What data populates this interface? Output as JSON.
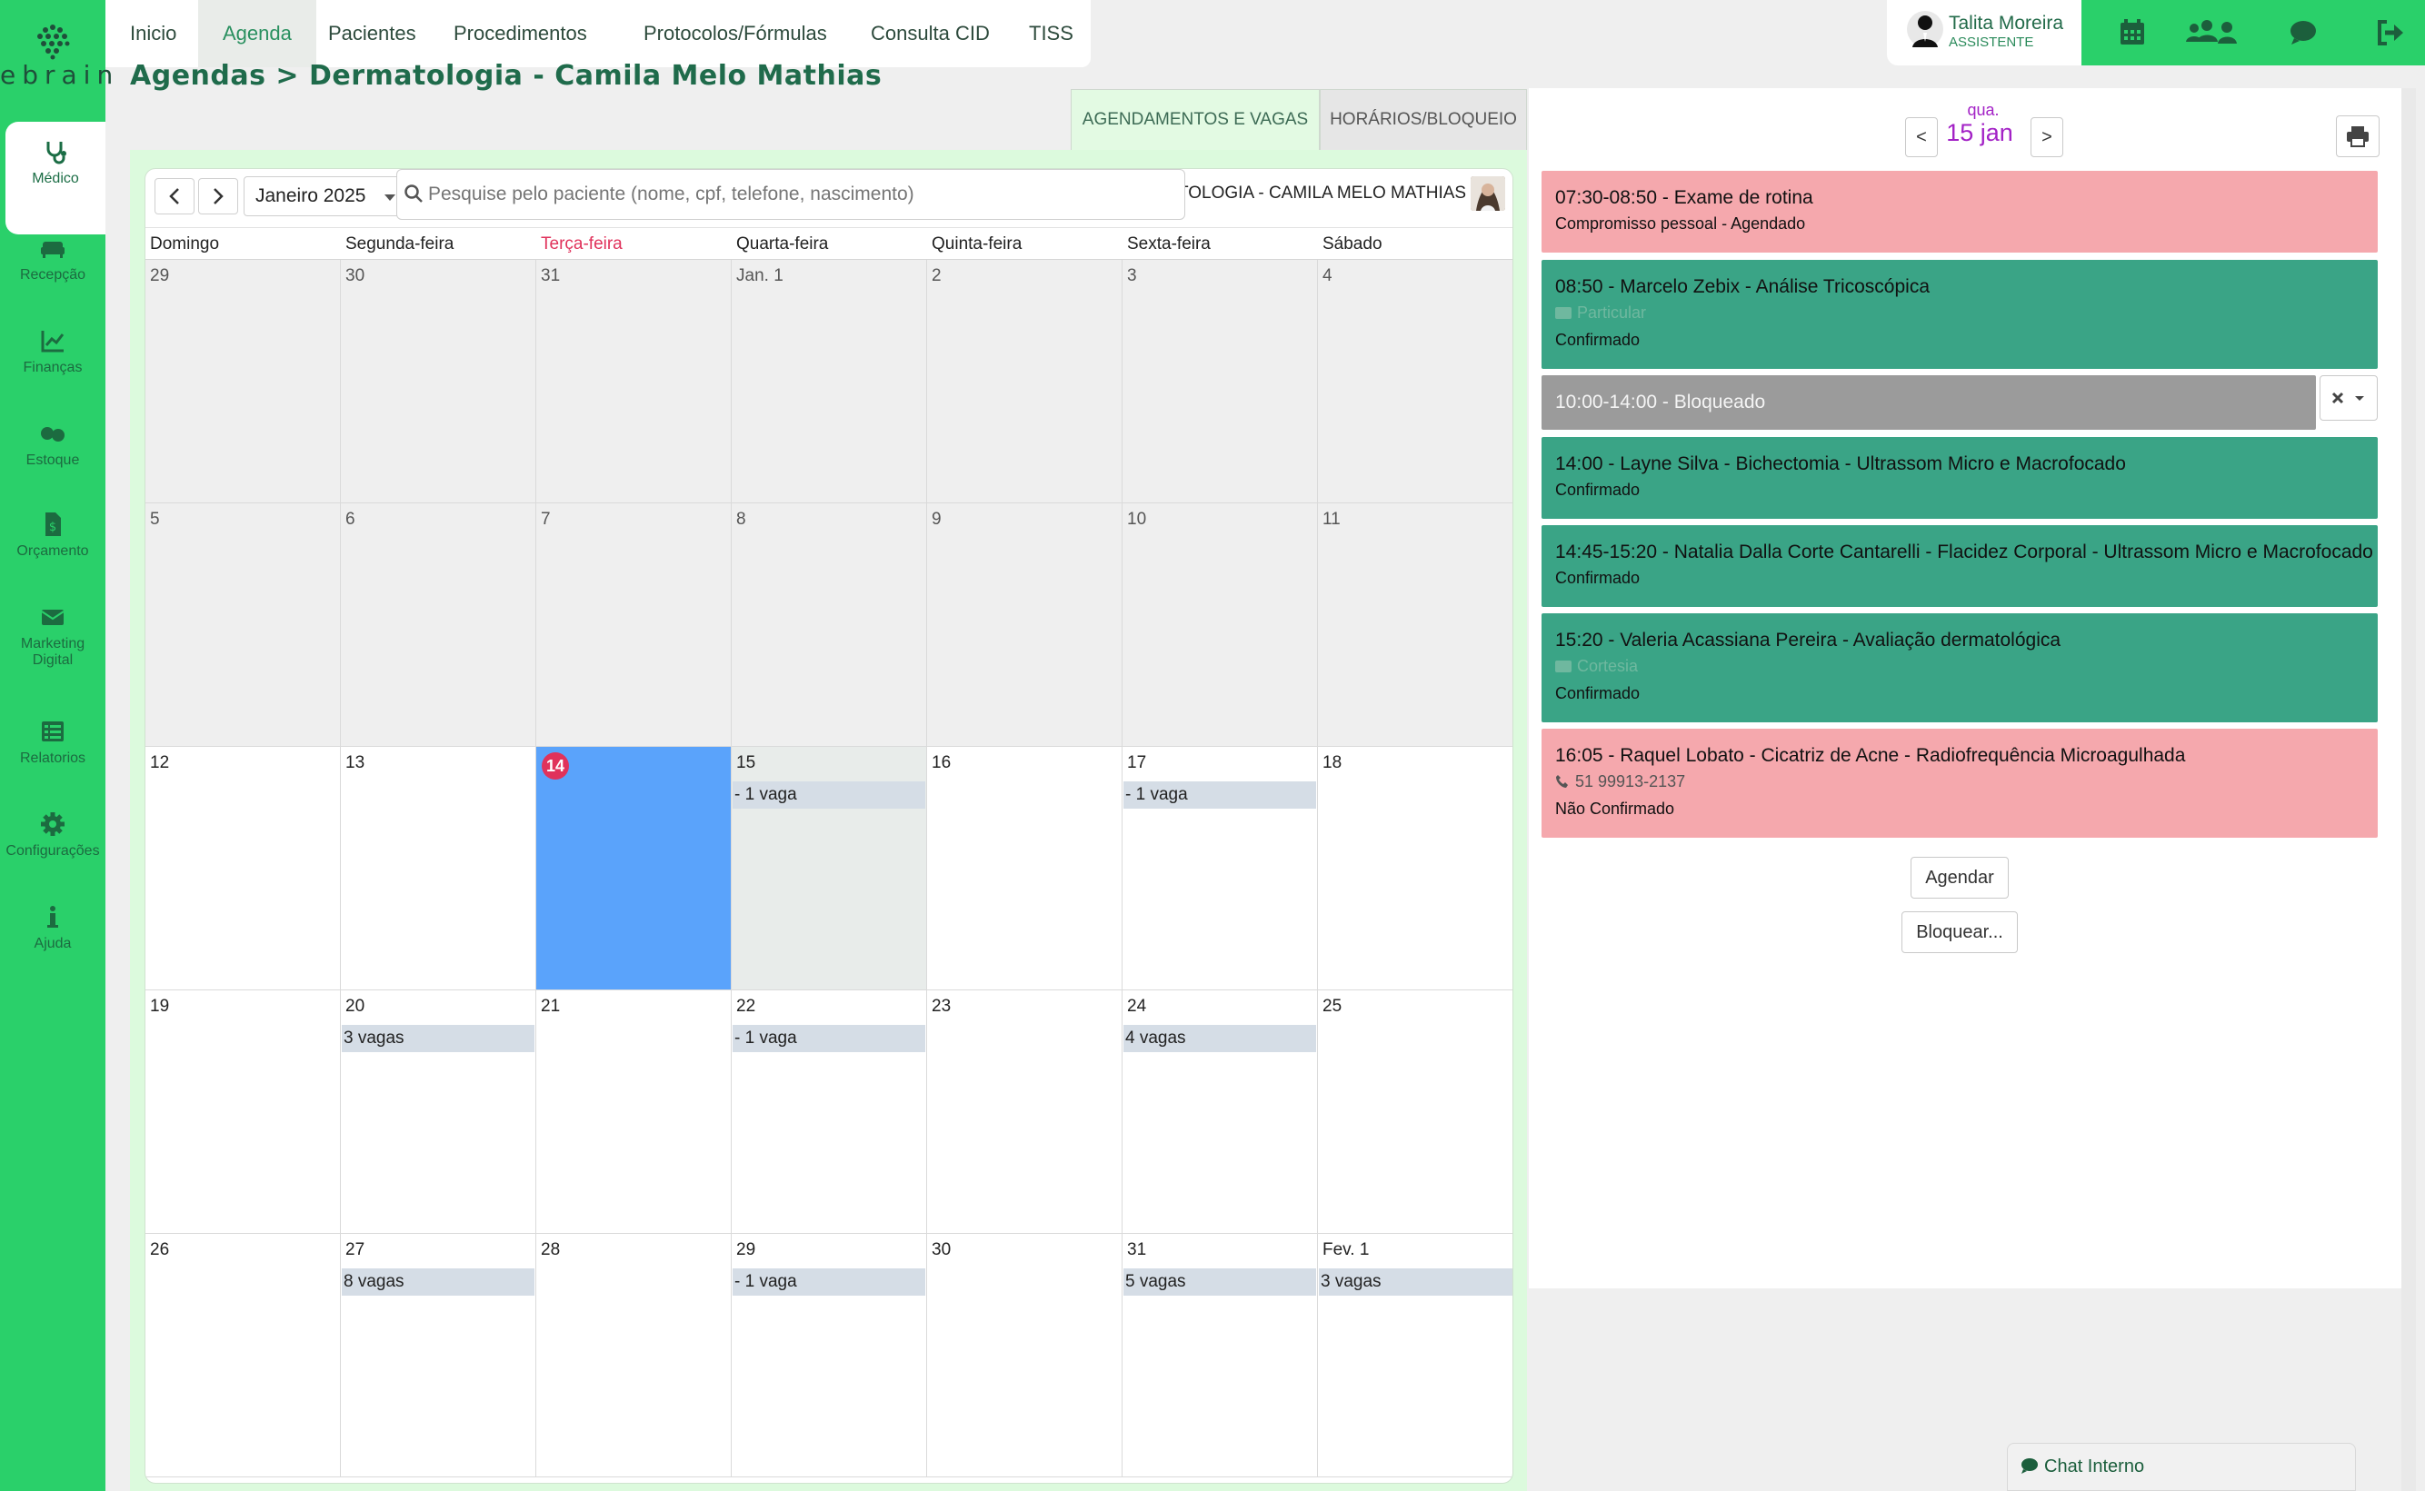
{
  "app": {
    "logo_text": "ebrain"
  },
  "sidebar": {
    "items": [
      {
        "label": "Médico",
        "icon": "stethoscope-icon"
      },
      {
        "label": "Recepção",
        "icon": "sofa-icon"
      },
      {
        "label": "Finanças",
        "icon": "chart-line-icon"
      },
      {
        "label": "Estoque",
        "icon": "pills-icon"
      },
      {
        "label": "Orçamento",
        "icon": "invoice-icon"
      },
      {
        "label": "Marketing",
        "label2": "Digital",
        "icon": "envelope-icon"
      },
      {
        "label": "Relatorios",
        "icon": "list-icon"
      },
      {
        "label": "Configurações",
        "icon": "gear-icon"
      },
      {
        "label": "Ajuda",
        "icon": "info-icon"
      }
    ]
  },
  "topnav": {
    "items": [
      "Inicio",
      "Agenda",
      "Pacientes",
      "Procedimentos",
      "Protocolos/Fórmulas",
      "Consulta CID",
      "TISS"
    ],
    "active": "Agenda"
  },
  "user": {
    "name": "Talita Moreira",
    "role": "ASSISTENTE"
  },
  "page": {
    "title": "Agendas > Dermatologia - Camila Melo Mathias"
  },
  "tabs": {
    "agendamentos": "AGENDAMENTOS E VAGAS",
    "horarios": "HORÁRIOS/BLOQUEIO"
  },
  "calendar": {
    "month_select": "Janeiro 2025",
    "search_placeholder": "Pesquise pelo paciente (nome, cpf, telefone, nascimento)",
    "doctor_label": "TOLOGIA - CAMILA MELO MATHIAS",
    "weekdays": [
      "Domingo",
      "Segunda-feira",
      "Terça-feira",
      "Quarta-feira",
      "Quinta-feira",
      "Sexta-feira",
      "Sábado"
    ],
    "weeks": [
      [
        {
          "d": "29",
          "past": true
        },
        {
          "d": "30",
          "past": true
        },
        {
          "d": "31",
          "past": true
        },
        {
          "d": "Jan. 1",
          "past": true
        },
        {
          "d": "2",
          "past": true
        },
        {
          "d": "3",
          "past": true
        },
        {
          "d": "4",
          "past": true
        }
      ],
      [
        {
          "d": "5",
          "past": true
        },
        {
          "d": "6",
          "past": true
        },
        {
          "d": "7",
          "past": true
        },
        {
          "d": "8",
          "past": true
        },
        {
          "d": "9",
          "past": true
        },
        {
          "d": "10",
          "past": true
        },
        {
          "d": "11",
          "past": true
        }
      ],
      [
        {
          "d": "12"
        },
        {
          "d": "13"
        },
        {
          "d": "14",
          "today": true
        },
        {
          "d": "15",
          "light": true,
          "vaga": "- 1 vaga"
        },
        {
          "d": "16"
        },
        {
          "d": "17",
          "vaga": "- 1 vaga"
        },
        {
          "d": "18"
        }
      ],
      [
        {
          "d": "19"
        },
        {
          "d": "20",
          "vaga": "3 vagas"
        },
        {
          "d": "21"
        },
        {
          "d": "22",
          "vaga": "- 1 vaga"
        },
        {
          "d": "23"
        },
        {
          "d": "24",
          "vaga": "4 vagas"
        },
        {
          "d": "25"
        }
      ],
      [
        {
          "d": "26"
        },
        {
          "d": "27",
          "vaga": "8 vagas"
        },
        {
          "d": "28"
        },
        {
          "d": "29",
          "vaga": "- 1 vaga"
        },
        {
          "d": "30"
        },
        {
          "d": "31",
          "vaga": "5 vagas"
        },
        {
          "d": "Fev. 1",
          "vaga": "3 vagas"
        }
      ]
    ]
  },
  "day": {
    "prev": "<",
    "next": ">",
    "weekday": "qua.",
    "date": "15 jan",
    "appointments": [
      {
        "color": "red",
        "l1": "07:30-08:50 - Exame de rotina",
        "l2": "Compromisso pessoal - Agendado"
      },
      {
        "color": "green",
        "l1": "08:50 - Marcelo Zebix - Análise Tricoscópica",
        "l2": "Particular",
        "l3": "Confirmado"
      },
      {
        "color": "gray",
        "l1": "10:00-14:00 - Bloqueado"
      },
      {
        "color": "green",
        "l1": "14:00 - Layne Silva - Bichectomia - Ultrassom Micro e Macrofocado",
        "l2": "Confirmado"
      },
      {
        "color": "green",
        "l1": "14:45-15:20 - Natalia Dalla Corte Cantarelli - Flacidez Corporal - Ultrassom Micro e Macrofocado",
        "l2": "Confirmado"
      },
      {
        "color": "green",
        "l1": "15:20 - Valeria Acassiana Pereira - Avaliação dermatológica",
        "l2": "Cortesia",
        "l3": "Confirmado"
      },
      {
        "color": "red",
        "l1": "16:05 - Raquel Lobato - Cicatriz de Acne - Radiofrequência Microagulhada",
        "l2": "51 99913-2137",
        "l3": "Não Confirmado"
      }
    ],
    "agendar": "Agendar",
    "bloquear": "Bloquear..."
  },
  "chat": {
    "label": "Chat Interno"
  },
  "colors": {
    "sidebar": "#2ad06a",
    "title": "#1f6b4b",
    "today": "#e0325b",
    "selected": "#5aa3fb",
    "appt_green": "#3aa486",
    "appt_red": "#f5a8ad",
    "appt_gray": "#9b9b9b",
    "date_purple": "#a322c6"
  }
}
